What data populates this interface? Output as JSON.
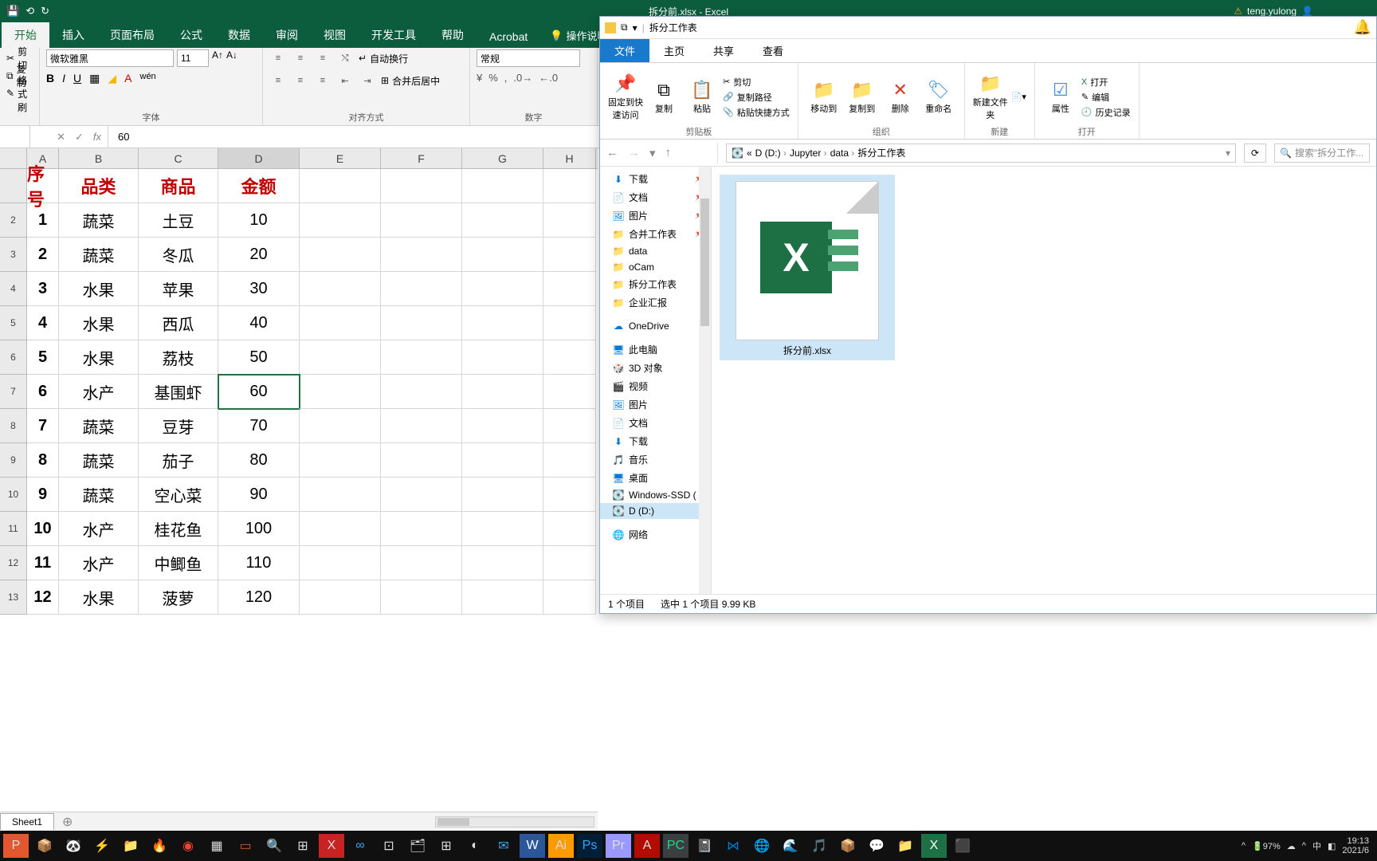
{
  "excel": {
    "title": "拆分前.xlsx - Excel",
    "user": "teng.yulong",
    "qat": {
      "save": "💾",
      "undo": "⟲",
      "redo": "↻"
    },
    "tabs": [
      "开始",
      "插入",
      "页面布局",
      "公式",
      "数据",
      "审阅",
      "视图",
      "开发工具",
      "帮助",
      "Acrobat"
    ],
    "tell_me": "操作说明搜索",
    "clipboard": {
      "cut": "剪切",
      "copy": "复制",
      "painter": "格式刷"
    },
    "font": {
      "name": "微软雅黑",
      "size": "11",
      "group": "字体"
    },
    "align": {
      "wrap": "自动换行",
      "merge": "合并后居中",
      "group": "对齐方式"
    },
    "number": {
      "format": "常规",
      "group": "数字"
    },
    "formula_bar": {
      "name": "",
      "fx": "fx",
      "value": "60"
    },
    "selected_cell": "D7"
  },
  "grid": {
    "cols": [
      "A",
      "B",
      "C",
      "D",
      "E",
      "F",
      "G",
      "H"
    ],
    "headers": [
      "序号",
      "品类",
      "商品",
      "金额"
    ],
    "rows": [
      {
        "n": "1",
        "a": "1",
        "b": "蔬菜",
        "c": "土豆",
        "d": "10"
      },
      {
        "n": "2",
        "a": "2",
        "b": "蔬菜",
        "c": "冬瓜",
        "d": "20"
      },
      {
        "n": "3",
        "a": "3",
        "b": "水果",
        "c": "苹果",
        "d": "30"
      },
      {
        "n": "4",
        "a": "4",
        "b": "水果",
        "c": "西瓜",
        "d": "40"
      },
      {
        "n": "5",
        "a": "5",
        "b": "水果",
        "c": "荔枝",
        "d": "50"
      },
      {
        "n": "6",
        "a": "6",
        "b": "水产",
        "c": "基围虾",
        "d": "60"
      },
      {
        "n": "7",
        "a": "7",
        "b": "蔬菜",
        "c": "豆芽",
        "d": "70"
      },
      {
        "n": "8",
        "a": "8",
        "b": "蔬菜",
        "c": "茄子",
        "d": "80"
      },
      {
        "n": "9",
        "a": "9",
        "b": "蔬菜",
        "c": "空心菜",
        "d": "90"
      },
      {
        "n": "10",
        "a": "10",
        "b": "水产",
        "c": "桂花鱼",
        "d": "100"
      },
      {
        "n": "11",
        "a": "11",
        "b": "水产",
        "c": "中鲫鱼",
        "d": "110"
      },
      {
        "n": "12",
        "a": "12",
        "b": "水果",
        "c": "菠萝",
        "d": "120"
      }
    ],
    "sheet": "Sheet1"
  },
  "explorer": {
    "title": "拆分工作表",
    "tabs": [
      "文件",
      "主页",
      "共享",
      "查看"
    ],
    "ribbon": {
      "pin": "固定到快速访问",
      "copy": "复制",
      "paste": "粘贴",
      "cut": "剪切",
      "copypath": "复制路径",
      "pastesc": "粘贴快捷方式",
      "clipboard": "剪贴板",
      "moveto": "移动到",
      "copyto": "复制到",
      "delete": "删除",
      "rename": "重命名",
      "organize": "组织",
      "newfolder": "新建文件夹",
      "new": "新建",
      "props": "属性",
      "open": "打开",
      "edit": "编辑",
      "history": "历史记录",
      "openg": "打开"
    },
    "path": [
      "D (D:)",
      "Jupyter",
      "data",
      "拆分工作表"
    ],
    "search_ph": "搜索\"拆分工作...",
    "nav": {
      "quick": [
        "下载",
        "文档",
        "图片",
        "合并工作表",
        "data",
        "oCam",
        "拆分工作表",
        "企业汇报"
      ],
      "onedrive": "OneDrive",
      "pc": "此电脑",
      "pc_items": [
        "3D 对象",
        "视频",
        "图片",
        "文档",
        "下载",
        "音乐",
        "桌面",
        "Windows-SSD (",
        "D (D:)"
      ],
      "network": "网络"
    },
    "file": {
      "name": "拆分前.xlsx"
    },
    "status": {
      "count": "1 个项目",
      "sel": "选中 1 个项目 9.99 KB"
    }
  },
  "taskbar": {
    "battery": "97%",
    "ime": "中",
    "time": "19:13",
    "date": "2021/6"
  }
}
